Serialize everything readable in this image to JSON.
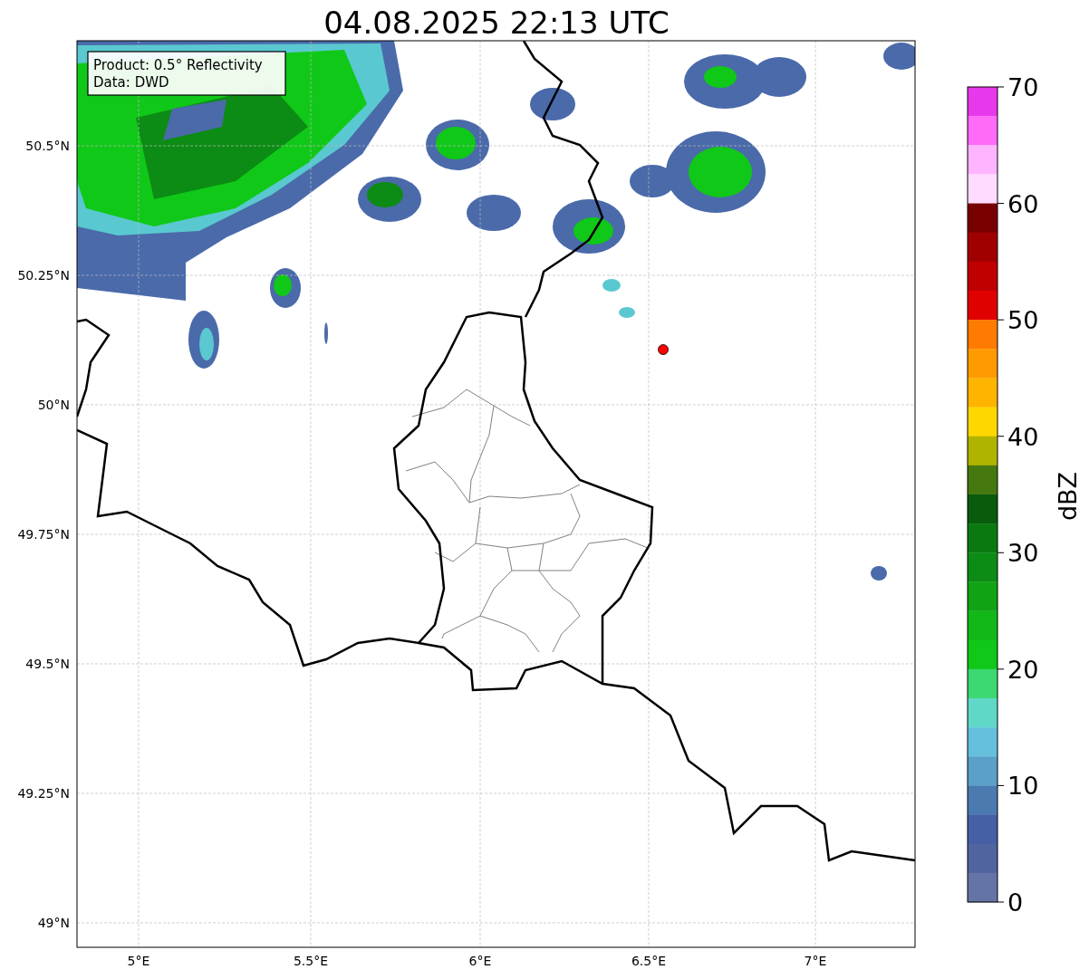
{
  "title": "04.08.2025 22:13 UTC",
  "legend": [
    "Product: 0.5° Reflectivity",
    "Data: DWD"
  ],
  "x_ticks": [
    "5°E",
    "5.5°E",
    "6°E",
    "6.5°E",
    "7°E"
  ],
  "y_ticks": [
    "50.5°N",
    "50.25°N",
    "50°N",
    "49.75°N",
    "49.5°N",
    "49.25°N",
    "49°N"
  ],
  "colorbar": {
    "label": "dBZ",
    "ticks": [
      "70",
      "60",
      "50",
      "40",
      "30",
      "20",
      "10",
      "0"
    ],
    "bands": [
      {
        "color": "#e838ec"
      },
      {
        "color": "#ff6af8"
      },
      {
        "color": "#ffb4ff"
      },
      {
        "color": "#ffdcff"
      },
      {
        "color": "#780000"
      },
      {
        "color": "#a00000"
      },
      {
        "color": "#c00000"
      },
      {
        "color": "#e00000"
      },
      {
        "color": "#ff7a00"
      },
      {
        "color": "#ff9a00"
      },
      {
        "color": "#ffb400"
      },
      {
        "color": "#ffd700"
      },
      {
        "color": "#b0b400"
      },
      {
        "color": "#467810"
      },
      {
        "color": "#085c0c"
      },
      {
        "color": "#0a7a10"
      },
      {
        "color": "#0c8c14"
      },
      {
        "color": "#10a414"
      },
      {
        "color": "#12b818"
      },
      {
        "color": "#10c818"
      },
      {
        "color": "#3cd872"
      },
      {
        "color": "#60d8c8"
      },
      {
        "color": "#64c0dc"
      },
      {
        "color": "#5aa0c8"
      },
      {
        "color": "#4a7ab0"
      },
      {
        "color": "#4560a4"
      },
      {
        "color": "#5064a0"
      },
      {
        "color": "#6474a6"
      }
    ]
  }
}
